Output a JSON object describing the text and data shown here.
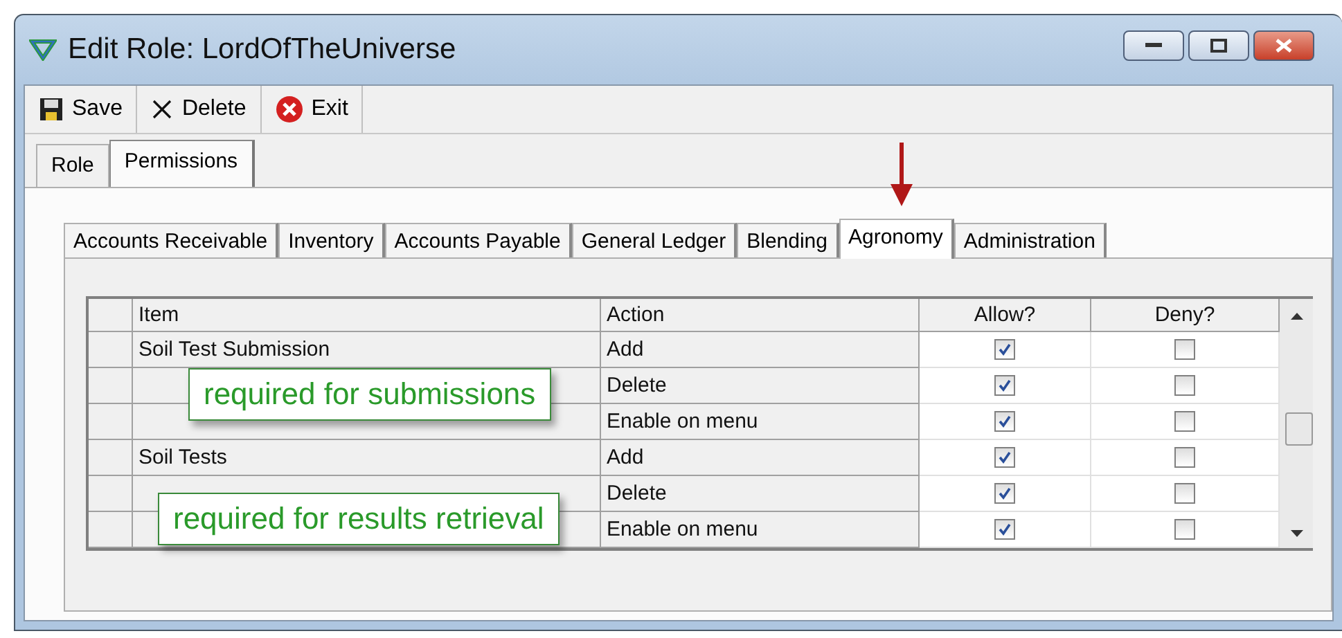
{
  "window": {
    "title": "Edit Role: LordOfTheUniverse"
  },
  "toolbar": [
    {
      "kind": "save",
      "label": "Save"
    },
    {
      "kind": "delete",
      "label": "Delete"
    },
    {
      "kind": "exit",
      "label": "Exit"
    }
  ],
  "tabs": [
    {
      "label": "Role",
      "selected": false
    },
    {
      "label": "Permissions",
      "selected": true
    }
  ],
  "subtabs": [
    {
      "label": "Accounts Receivable",
      "selected": false
    },
    {
      "label": "Inventory",
      "selected": false
    },
    {
      "label": "Accounts Payable",
      "selected": false
    },
    {
      "label": "General Ledger",
      "selected": false
    },
    {
      "label": "Blending",
      "selected": false
    },
    {
      "label": "Agronomy",
      "selected": true
    },
    {
      "label": "Administration",
      "selected": false
    }
  ],
  "table": {
    "columns": [
      "Item",
      "Action",
      "Allow?",
      "Deny?"
    ],
    "rows": [
      {
        "item": "Soil Test Submission",
        "action": "Add",
        "allow": true,
        "deny": false
      },
      {
        "item": "",
        "action": "Delete",
        "allow": true,
        "deny": false
      },
      {
        "item": "",
        "action": "Enable on menu",
        "allow": true,
        "deny": false
      },
      {
        "item": "Soil Tests",
        "action": "Add",
        "allow": true,
        "deny": false
      },
      {
        "item": "",
        "action": "Delete",
        "allow": true,
        "deny": false
      },
      {
        "item": "",
        "action": "Enable on menu",
        "allow": true,
        "deny": false
      }
    ]
  },
  "callouts": [
    {
      "text": "required for submissions"
    },
    {
      "text": "required for results retrieval"
    }
  ]
}
